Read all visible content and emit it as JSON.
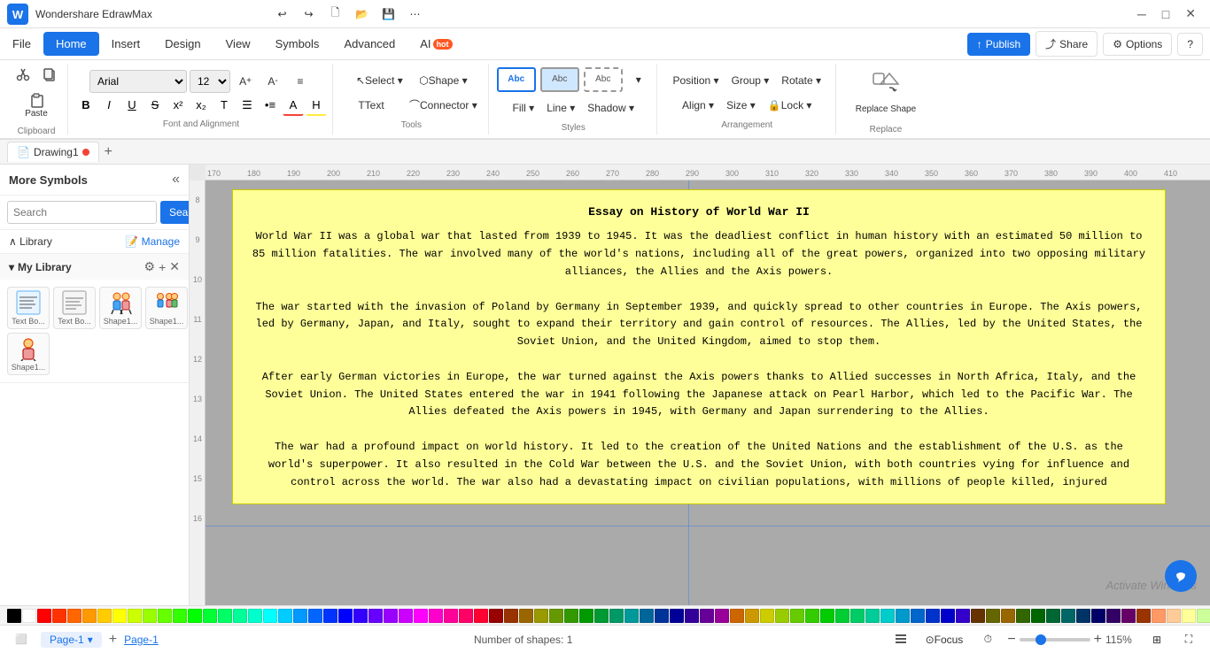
{
  "app": {
    "name": "Wondershare EdrawMax",
    "logo_text": "W"
  },
  "titlebar": {
    "undo": "↩",
    "redo": "↪",
    "new": "🗋",
    "open": "📂",
    "save": "💾",
    "more": "⋯",
    "min": "─",
    "max": "□",
    "close": "✕"
  },
  "menubar": {
    "items": [
      "File",
      "Home",
      "Insert",
      "Design",
      "View",
      "Symbols",
      "Advanced",
      "AI"
    ],
    "active": "Home",
    "right": {
      "publish": "Publish",
      "share": "Share",
      "options": "Options",
      "help": "?"
    }
  },
  "toolbar": {
    "sections": {
      "clipboard": {
        "label": "Clipboard",
        "cut": "✂",
        "copy": "⎘",
        "paste": "📋"
      },
      "font": {
        "label": "Font and Alignment",
        "family": "Arial",
        "size": "12",
        "increase": "A+",
        "decrease": "A-",
        "align": "≡",
        "bold": "B",
        "italic": "I",
        "underline": "U",
        "strike": "S",
        "super": "x²",
        "sub": "x₂",
        "text_style": "T",
        "list": "☰",
        "bullet": "•",
        "font_color": "A",
        "highlight": "H"
      },
      "tools": {
        "label": "Tools",
        "select": "Select ▾",
        "shape": "Shape ▾",
        "text": "Text",
        "connector": "Connector ▾"
      },
      "styles": {
        "label": "Styles",
        "fill": "Fill ▾",
        "line": "Line ▾",
        "shadow": "Shadow ▾",
        "more": "▾"
      },
      "arrangement": {
        "label": "Arrangement",
        "position": "Position ▾",
        "group": "Group ▾",
        "rotate": "Rotate ▾",
        "align": "Align ▾",
        "size": "Size ▾",
        "lock": "Lock ▾"
      },
      "replace": {
        "label": "Replace",
        "replace_shape": "Replace Shape"
      }
    }
  },
  "tabs": {
    "drawing_name": "Drawing1",
    "add": "+"
  },
  "sidebar": {
    "title": "More Symbols",
    "collapse": "«",
    "search": {
      "placeholder": "Search",
      "label": "Search",
      "button": "Search"
    },
    "library": {
      "label": "Library",
      "manage": "Manage",
      "chevron": "∧"
    },
    "my_library": {
      "label": "My Library",
      "chevron": "▾",
      "add": "+",
      "close": "✕",
      "shapes": [
        {
          "label": "Text Bo...",
          "type": "text"
        },
        {
          "label": "Text Bo...",
          "type": "text2"
        },
        {
          "label": "Shape1...",
          "type": "shape1"
        },
        {
          "label": "Shape1...",
          "type": "shape2"
        },
        {
          "label": "Shape1...",
          "type": "shape3"
        }
      ]
    }
  },
  "canvas": {
    "document_title": "Essay on History of World War II",
    "document_body": "World War II was a global war that lasted from 1939 to 1945. It was the deadliest conflict in human history with an estimated 50 million to 85 million fatalities. The war involved many of the world's nations, including all of the great powers, organized into two opposing military alliances, the Allies and the Axis powers.\nThe war started with the invasion of Poland by Germany in September 1939, and quickly spread to other countries in Europe. The Axis powers, led by Germany, Japan, and Italy, sought to expand their territory and gain control of resources. The Allies, led by the United States, the Soviet Union, and the United Kingdom, aimed to stop them.\nAfter early German victories in Europe, the war turned against the Axis powers thanks to Allied successes in North Africa, Italy, and the Soviet Union. The United States entered the war in 1941 following the Japanese attack on Pearl Harbor, which led to the Pacific War. The Allies defeated the Axis powers in 1945, with Germany and Japan surrendering to the Allies.\nThe war had a profound impact on world history. It led to the creation of the United Nations and the establishment of the U.S. as the world's superpower. It also resulted in the Cold War between the U.S. and the Soviet Union, with both countries vying for influence and control across the world. The war also had a devastating impact on civilian populations, with millions of people killed, injured",
    "watermark": "Activate Windows"
  },
  "statusbar": {
    "page_label": "Page-1",
    "page_selector": "Page-1",
    "shapes_count": "Number of shapes: 1",
    "focus": "Focus",
    "zoom": "115%",
    "zoom_icon": "⊕"
  },
  "colors": [
    "#000000",
    "#ffffff",
    "#ff0000",
    "#ff3300",
    "#ff6600",
    "#ff9900",
    "#ffcc00",
    "#ffff00",
    "#ccff00",
    "#99ff00",
    "#66ff00",
    "#33ff00",
    "#00ff00",
    "#00ff33",
    "#00ff66",
    "#00ff99",
    "#00ffcc",
    "#00ffff",
    "#00ccff",
    "#0099ff",
    "#0066ff",
    "#0033ff",
    "#0000ff",
    "#3300ff",
    "#6600ff",
    "#9900ff",
    "#cc00ff",
    "#ff00ff",
    "#ff00cc",
    "#ff0099",
    "#ff0066",
    "#ff0033",
    "#990000",
    "#993300",
    "#996600",
    "#999900",
    "#669900",
    "#339900",
    "#009900",
    "#009933",
    "#009966",
    "#009999",
    "#006699",
    "#003399",
    "#000099",
    "#330099",
    "#660099",
    "#990099",
    "#cc6600",
    "#cc9900",
    "#cccc00",
    "#99cc00",
    "#66cc00",
    "#33cc00",
    "#00cc00",
    "#00cc33",
    "#00cc66",
    "#00cc99",
    "#00cccc",
    "#0099cc",
    "#0066cc",
    "#0033cc",
    "#0000cc",
    "#3300cc",
    "#663300",
    "#666600",
    "#996600",
    "#336600",
    "#006600",
    "#006633",
    "#006666",
    "#003366",
    "#000066",
    "#330066",
    "#660066",
    "#993300",
    "#ff9966",
    "#ffcc99",
    "#ffff99",
    "#ccff99",
    "#99ff99",
    "#99ffcc",
    "#99ffff",
    "#99ccff",
    "#9999ff",
    "#cc99ff",
    "#ff99ff",
    "#ff99cc"
  ]
}
